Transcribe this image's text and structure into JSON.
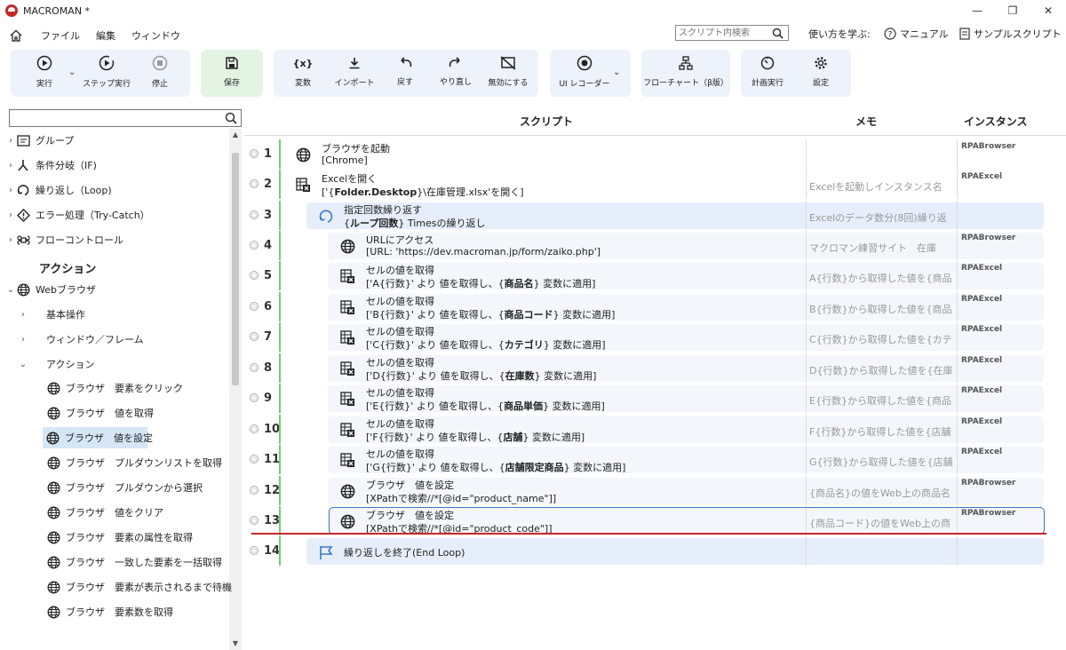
{
  "window": {
    "title": "MACROMAN *",
    "min": "—",
    "restore": "❐",
    "close": "✕"
  },
  "menu": {
    "items": [
      "ファイル",
      "編集",
      "ウィンドウ"
    ]
  },
  "search": {
    "placeholder": "スクリプト内検索"
  },
  "links": {
    "learn": "使い方を学ぶ:",
    "manual": "マニュアル",
    "sample": "サンプルスクリプト"
  },
  "toolbar": {
    "run": "実行",
    "step": "ステップ実行",
    "stop": "停止",
    "save": "保存",
    "variable": "変数",
    "import": "インポート",
    "undo": "戻す",
    "redo": "やり直し",
    "disable": "無効にする",
    "ui_recorder": "UI レコーダー",
    "flowchart": "フローチャート（β版）",
    "schedule": "計画実行",
    "settings": "設定"
  },
  "sidebar": {
    "categories": [
      "グループ",
      "条件分岐（IF)",
      "繰り返し（Loop)",
      "エラー処理（Try-Catch）",
      "フローコントロール"
    ],
    "action_header": "アクション",
    "web_browser": "Webブラウザ",
    "subs": [
      "基本操作",
      "ウィンドウ／フレーム",
      "アクション"
    ],
    "actions": [
      "ブラウザ　要素をクリック",
      "ブラウザ　値を取得",
      "ブラウザ　値を設定",
      "ブラウザ　プルダウンリストを取得",
      "ブラウザ　プルダウンから選択",
      "ブラウザ　値をクリア",
      "ブラウザ　要素の属性を取得",
      "ブラウザ　一致した要素を一括取得",
      "ブラウザ　要素が表示されるまで待機",
      "ブラウザ　要素数を取得"
    ]
  },
  "columns": {
    "script": "スクリプト",
    "memo": "メモ",
    "instance": "インスタンス"
  },
  "rows": [
    {
      "num": "1",
      "icon": "globe-icon",
      "title": "ブラウザを起動",
      "detail_pre": "[Chrome]",
      "bold": "",
      "detail_post": "",
      "memo": "",
      "instance": "RPABrowser"
    },
    {
      "num": "2",
      "icon": "excel-icon",
      "title": "Excelを開く",
      "detail_pre": "['{",
      "bold": "Folder.Desktop",
      "detail_post": "}\\在庫管理.xlsx'を開く]",
      "memo": "Excelを起動しインスタンス名",
      "instance": "RPAExcel"
    },
    {
      "num": "3",
      "icon": "loop-icon",
      "title": "指定回数繰り返す",
      "detail_pre": "{",
      "bold": "ループ回数",
      "detail_post": "} Timesの繰り返し",
      "memo": "Excelのデータ数分(8回)繰り返",
      "instance": ""
    },
    {
      "num": "4",
      "icon": "globe-icon",
      "title": "URLにアクセス",
      "detail_pre": "[URL: 'https://dev.macroman.jp/form/zaiko.php']",
      "bold": "",
      "detail_post": "",
      "memo": "マクロマン練習サイト　在庫",
      "instance": "RPABrowser"
    },
    {
      "num": "5",
      "icon": "excel-icon",
      "title": "セルの値を取得",
      "detail_pre": "['A{行数}' より 値を取得し、{",
      "bold": "商品名",
      "detail_post": "} 変数に適用]",
      "memo": "A{行数}から取得した値を{商品",
      "instance": "RPAExcel"
    },
    {
      "num": "6",
      "icon": "excel-icon",
      "title": "セルの値を取得",
      "detail_pre": "['B{行数}' より 値を取得し、{",
      "bold": "商品コード",
      "detail_post": "} 変数に適用]",
      "memo": "B{行数}から取得した値を{商品",
      "instance": "RPAExcel"
    },
    {
      "num": "7",
      "icon": "excel-icon",
      "title": "セルの値を取得",
      "detail_pre": "['C{行数}' より 値を取得し、{",
      "bold": "カテゴリ",
      "detail_post": "} 変数に適用]",
      "memo": "C{行数}から取得した値を{カテ",
      "instance": "RPAExcel"
    },
    {
      "num": "8",
      "icon": "excel-icon",
      "title": "セルの値を取得",
      "detail_pre": "['D{行数}' より 値を取得し、{",
      "bold": "在庫数",
      "detail_post": "} 変数に適用]",
      "memo": "D{行数}から取得した値を{在庫",
      "instance": "RPAExcel"
    },
    {
      "num": "9",
      "icon": "excel-icon",
      "title": "セルの値を取得",
      "detail_pre": "['E{行数}' より 値を取得し、{",
      "bold": "商品単価",
      "detail_post": "} 変数に適用]",
      "memo": "E{行数}から取得した値を{商品",
      "instance": "RPAExcel"
    },
    {
      "num": "10",
      "icon": "excel-icon",
      "title": "セルの値を取得",
      "detail_pre": "['F{行数}' より 値を取得し、{",
      "bold": "店舗",
      "detail_post": "} 変数に適用]",
      "memo": "F{行数}から取得した値を{店舗",
      "instance": "RPAExcel"
    },
    {
      "num": "11",
      "icon": "excel-icon",
      "title": "セルの値を取得",
      "detail_pre": "['G{行数}' より 値を取得し、{",
      "bold": "店舗限定商品",
      "detail_post": "} 変数に適用]",
      "memo": "G{行数}から取得した値を{店舗",
      "instance": "RPAExcel"
    },
    {
      "num": "12",
      "icon": "globe-icon",
      "title": "ブラウザ　値を設定",
      "detail_pre": "[XPathで検索//*[@id=\"product_name\"]]",
      "bold": "",
      "detail_post": "",
      "memo": "{商品名}の値をWeb上の商品名",
      "instance": "RPABrowser"
    },
    {
      "num": "13",
      "icon": "globe-icon",
      "title": "ブラウザ　値を設定",
      "detail_pre": "[XPathで検索//*[@id=\"product_code\"]]",
      "bold": "",
      "detail_post": "",
      "memo": "{商品コード}の値をWeb上の商",
      "instance": "RPABrowser"
    },
    {
      "num": "14",
      "icon": "flag-icon",
      "title": "繰り返しを終了(End Loop)",
      "detail_pre": "",
      "bold": "",
      "detail_post": "",
      "memo": "",
      "instance": ""
    }
  ]
}
